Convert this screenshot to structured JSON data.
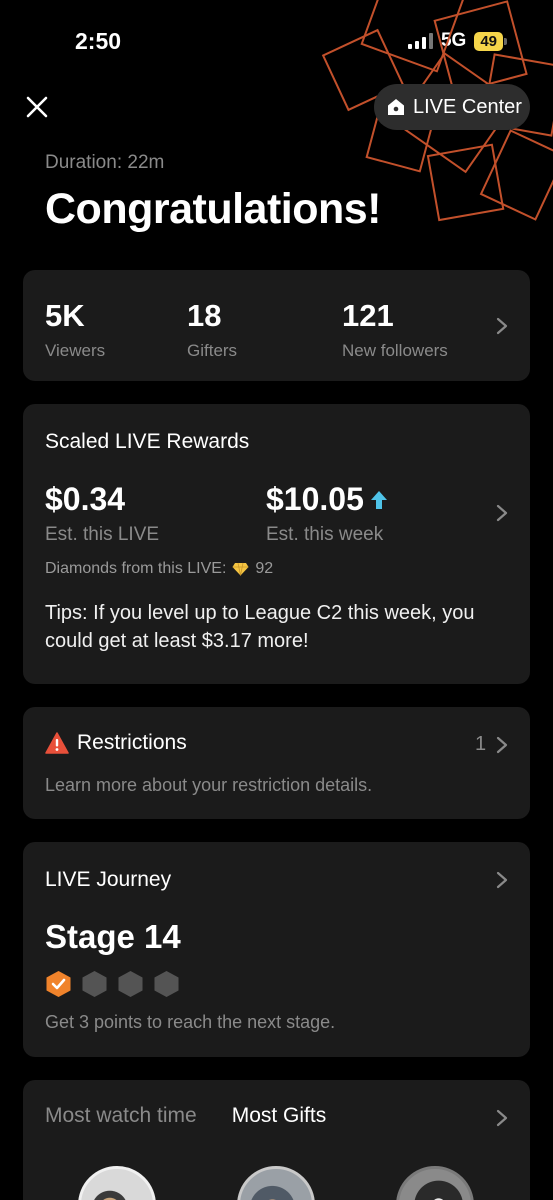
{
  "status_bar": {
    "time": "2:50",
    "network": "5G",
    "battery": "49"
  },
  "header": {
    "live_center_label": "LIVE Center",
    "duration": "Duration: 22m",
    "title": "Congratulations!"
  },
  "stats": [
    {
      "value": "5K",
      "label": "Viewers"
    },
    {
      "value": "18",
      "label": "Gifters"
    },
    {
      "value": "121",
      "label": "New followers"
    }
  ],
  "rewards": {
    "title": "Scaled LIVE Rewards",
    "this_live_amount": "$0.34",
    "this_live_label": "Est. this LIVE",
    "this_week_amount": "$10.05",
    "this_week_label": "Est. this week",
    "diamonds_label": "Diamonds from this LIVE:",
    "diamonds_value": "92",
    "tips": "Tips: If you level up to League C2 this week, you could get at least $3.17 more!"
  },
  "restrictions": {
    "title": "Restrictions",
    "count": "1",
    "description": "Learn more about your restriction details."
  },
  "journey": {
    "title": "LIVE Journey",
    "stage": "Stage 14",
    "hint": "Get 3 points to reach the next stage.",
    "stage_progress": {
      "completed": 1,
      "total": 4
    }
  },
  "rankings": {
    "tabs": [
      "Most watch time",
      "Most Gifts"
    ],
    "active_tab": 1
  },
  "colors": {
    "background": "#000000",
    "card": "#1b1b1b",
    "accent_orange": "#f0832b",
    "up_arrow": "#4fc3e8",
    "warning_red": "#e8503a",
    "muted_text": "#8a8a8a"
  }
}
